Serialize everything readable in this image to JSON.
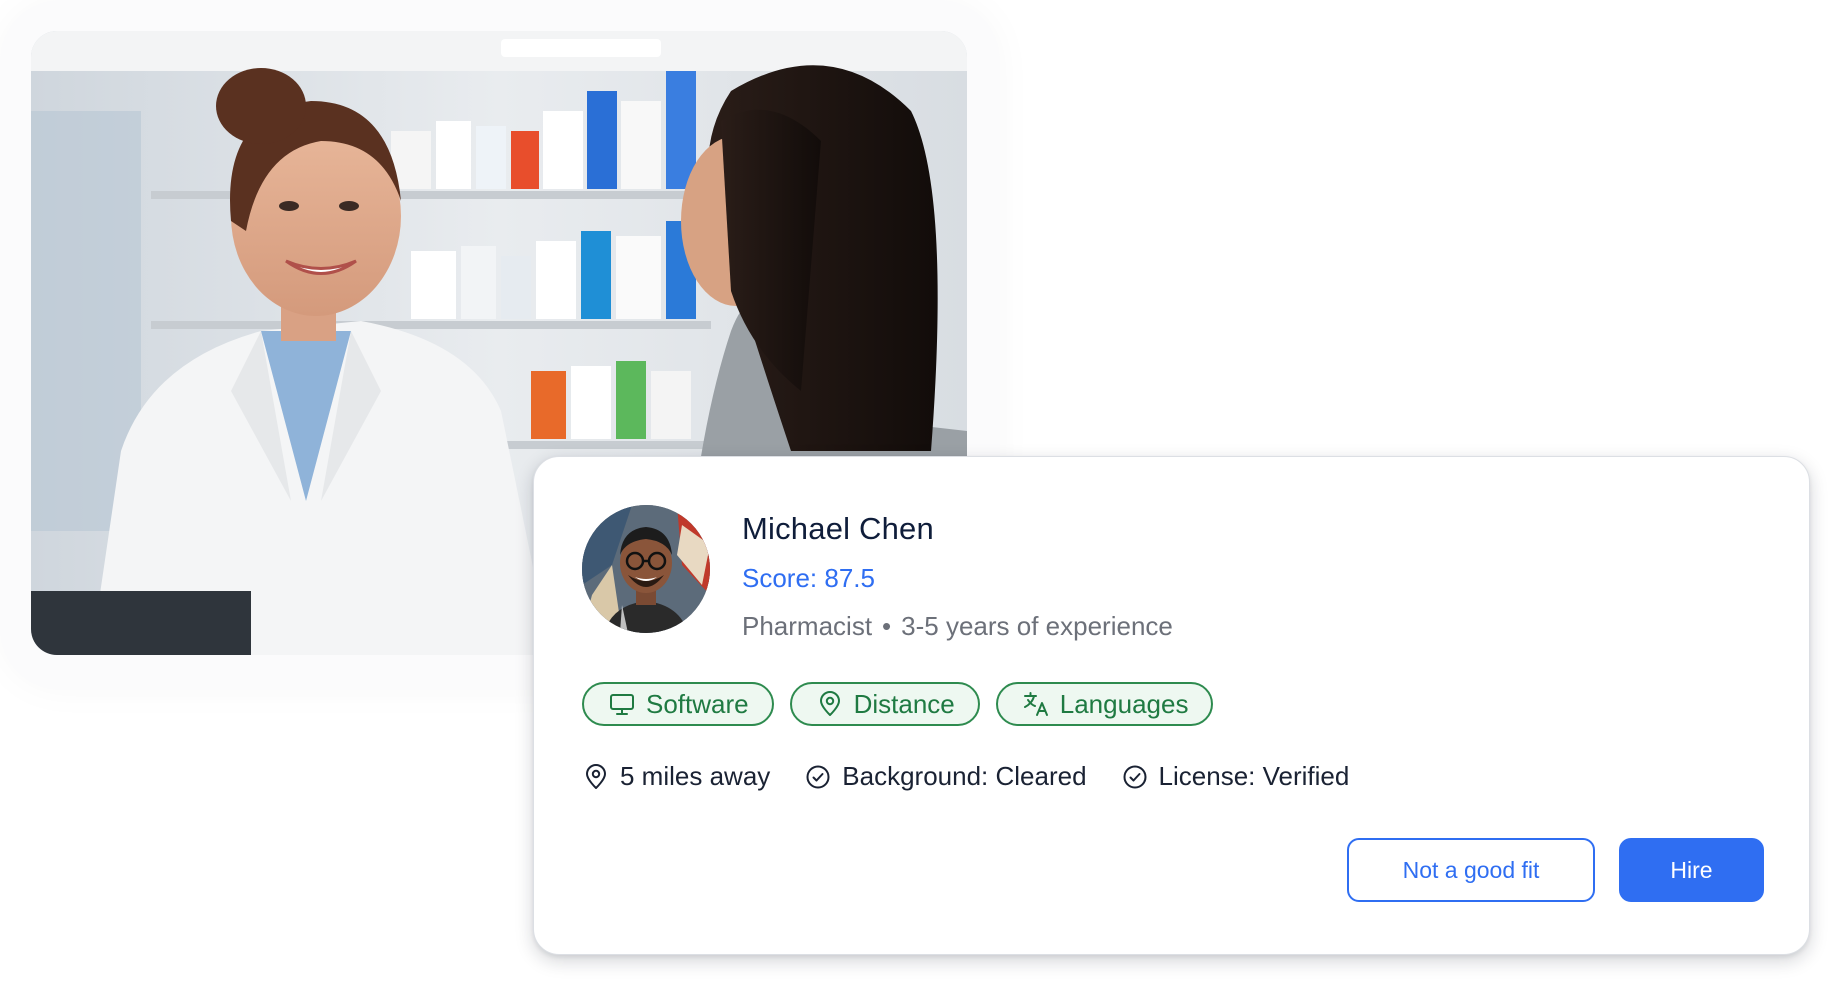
{
  "hero_photo": {
    "icon": "pharmacist-consultation-photo"
  },
  "candidate": {
    "name": "Michael Chen",
    "score": "Score: 87.5",
    "role": "Pharmacist",
    "separator": "•",
    "experience": "3-5 years of experience",
    "avatar_icon": "avatar-photo"
  },
  "tags": [
    {
      "label": "Software",
      "icon": "monitor-icon"
    },
    {
      "label": "Distance",
      "icon": "location-pin-icon"
    },
    {
      "label": "Languages",
      "icon": "translate-icon"
    }
  ],
  "facts": [
    {
      "label": "5 miles away",
      "icon": "location-pin-icon"
    },
    {
      "label": "Background: Cleared",
      "icon": "check-circle-icon"
    },
    {
      "label": "License: Verified",
      "icon": "check-circle-icon"
    }
  ],
  "actions": {
    "reject_label": "Not a good fit",
    "hire_label": "Hire"
  },
  "colors": {
    "accent": "#2f6ef2",
    "tag_green": "#1f7a42",
    "tag_bg": "#eef8f1",
    "name_text": "#0f1d3a",
    "muted_text": "#6c7079"
  }
}
